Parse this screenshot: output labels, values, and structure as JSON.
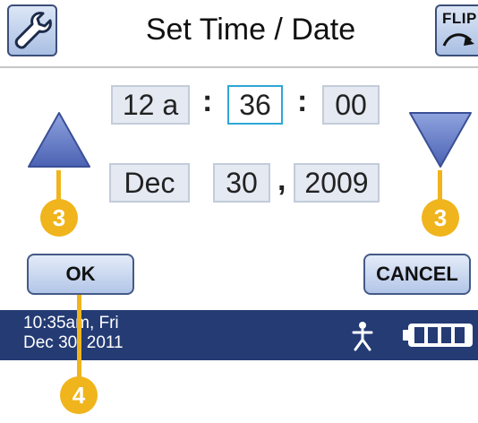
{
  "header": {
    "title": "Set Time / Date",
    "flip_label": "FLIP"
  },
  "time": {
    "hour": "12 a",
    "minute": "36",
    "second": "00",
    "separator": ":"
  },
  "date": {
    "month": "Dec",
    "day": "30",
    "comma": ",",
    "year": "2009"
  },
  "buttons": {
    "ok": "OK",
    "cancel": "CANCEL"
  },
  "callouts": {
    "left": "3",
    "right": "3",
    "ok": "4"
  },
  "status": {
    "time": "10:35am, Fri",
    "date": "Dec 30, 2011"
  },
  "colors": {
    "status_bar": "#243b74",
    "callout": "#f0b41c",
    "selected_border": "#2ea7d6",
    "arrow": "#5b74c2"
  }
}
